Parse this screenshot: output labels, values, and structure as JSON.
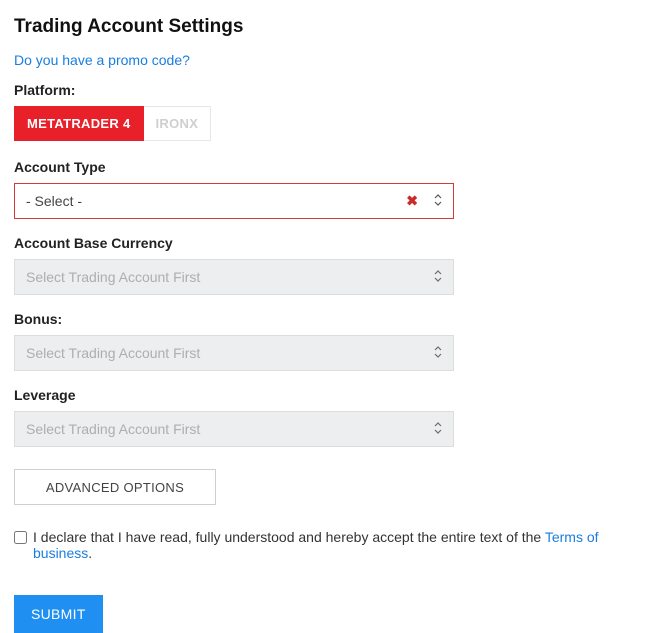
{
  "title": "Trading Account Settings",
  "promo_link": "Do you have a promo code?",
  "platform": {
    "label": "Platform:",
    "options": {
      "mt4": "METATRADER 4",
      "ironx": "IRONX"
    }
  },
  "account_type": {
    "label": "Account Type",
    "placeholder": "- Select -"
  },
  "base_currency": {
    "label": "Account Base Currency",
    "placeholder": "Select Trading Account First"
  },
  "bonus": {
    "label": "Bonus:",
    "placeholder": "Select Trading Account First"
  },
  "leverage": {
    "label": "Leverage",
    "placeholder": "Select Trading Account First"
  },
  "advanced_options_label": "ADVANCED OPTIONS",
  "declare": {
    "text_before": "I declare that I have read, fully understood and hereby accept the entire text of the ",
    "link": "Terms of business",
    "text_after": "."
  },
  "submit_label": "SUBMIT"
}
